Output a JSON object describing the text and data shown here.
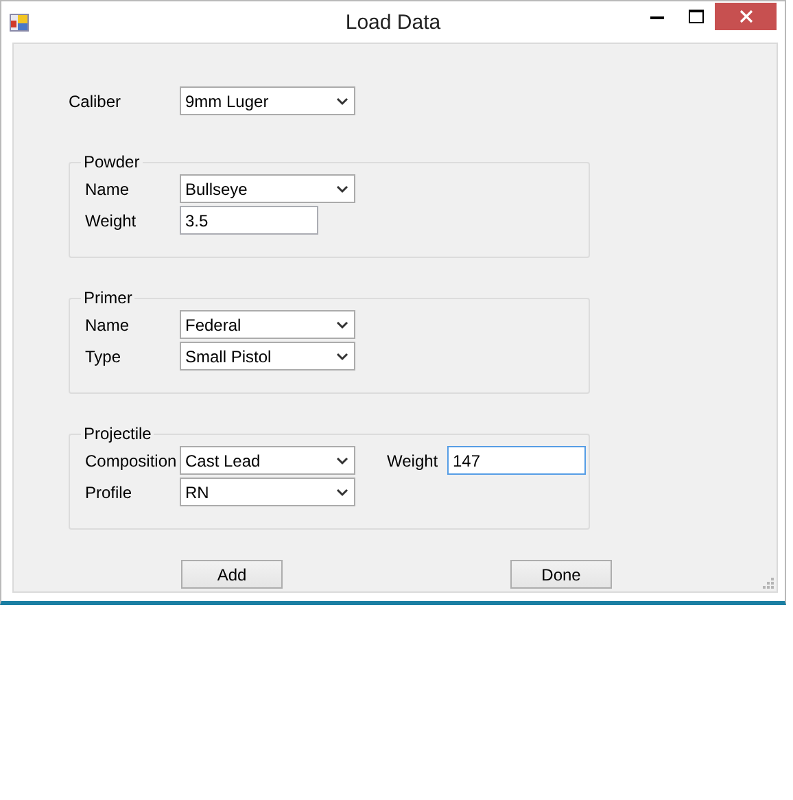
{
  "window": {
    "title": "Load Data"
  },
  "fields": [
    {
      "label": "Caliber",
      "kind": "combo",
      "value": "9mm Luger"
    }
  ],
  "groups": [
    {
      "title": "Powder",
      "rows": [
        [
          {
            "label": "Name",
            "kind": "combo",
            "value": "Bullseye"
          }
        ],
        [
          {
            "label": "Weight",
            "kind": "text",
            "value": "3.5",
            "focused": false
          }
        ]
      ]
    },
    {
      "title": "Primer",
      "rows": [
        [
          {
            "label": "Name",
            "kind": "combo",
            "value": "Federal"
          }
        ],
        [
          {
            "label": "Type",
            "kind": "combo",
            "value": "Small Pistol"
          }
        ]
      ]
    },
    {
      "title": "Projectile",
      "rows": [
        [
          {
            "label": "Composition",
            "kind": "combo",
            "value": "Cast Lead"
          },
          {
            "label": "Weight",
            "kind": "text",
            "value": "147",
            "focused": true
          }
        ],
        [
          {
            "label": "Profile",
            "kind": "combo",
            "value": "RN"
          }
        ]
      ]
    }
  ],
  "buttons": [
    "Add",
    "Done"
  ]
}
